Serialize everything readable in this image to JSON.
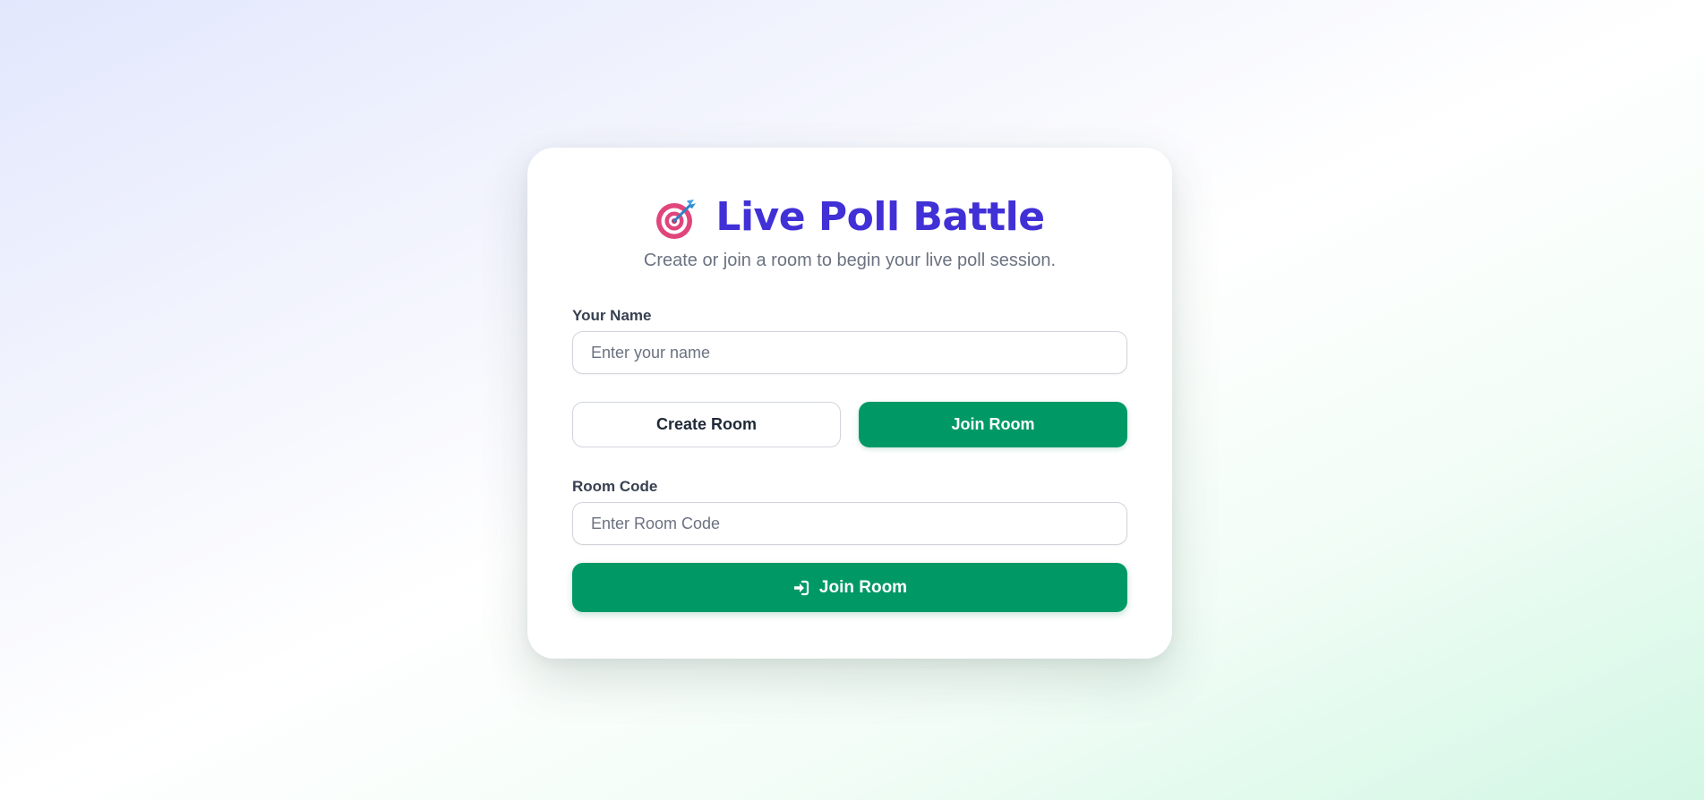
{
  "header": {
    "icon": "target-dart-icon",
    "title": "Live Poll Battle",
    "subtitle": "Create or join a room to begin your live poll session."
  },
  "name_field": {
    "label": "Your Name",
    "value": "",
    "placeholder": "Enter your name"
  },
  "mode_toggle": {
    "create_label": "Create Room",
    "join_label": "Join Room",
    "selected": "Join Room"
  },
  "room_code_field": {
    "label": "Room Code",
    "value": "",
    "placeholder": "Enter Room Code"
  },
  "submit": {
    "icon": "sign-in-icon",
    "label": "Join Room"
  },
  "colors": {
    "title": "#4130d6",
    "primary": "#009966",
    "subtitle": "#6b7280",
    "label": "#374151",
    "border": "#d1d5db"
  }
}
